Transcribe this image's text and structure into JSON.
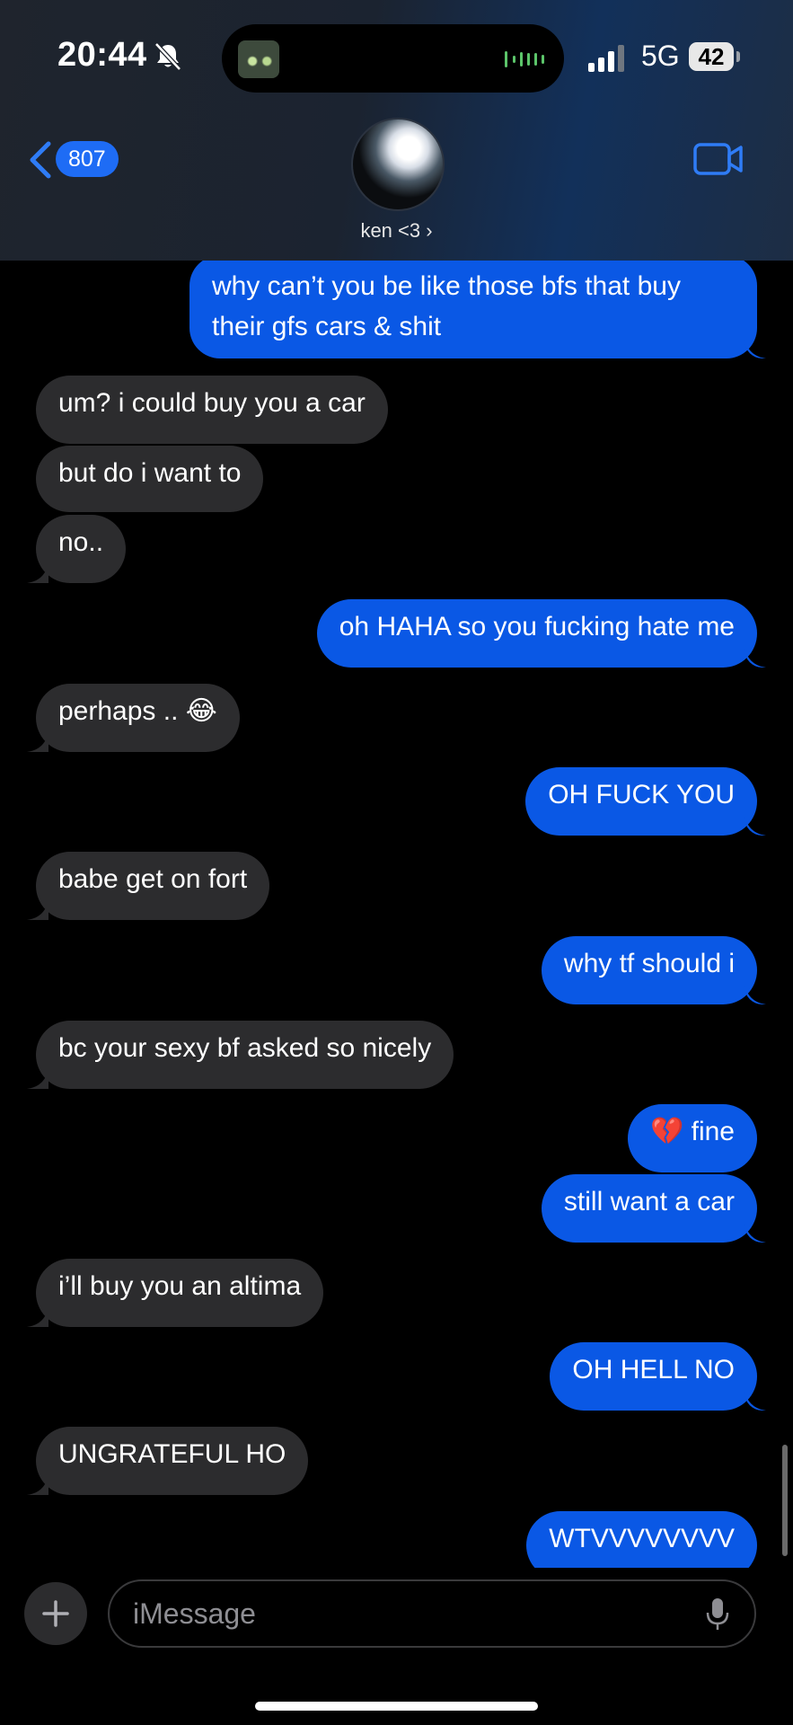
{
  "status_bar": {
    "time": "20:44",
    "network": "5G",
    "battery": "42"
  },
  "header": {
    "back_count": "807",
    "contact_name": "ken <3 ›"
  },
  "messages": [
    {
      "side": "sent",
      "text": "why can’t you be like those bfs that buy"
    },
    {
      "side": "sent",
      "text": "their gfs cars & shit"
    },
    {
      "side": "received",
      "text": "um? i could buy you a car"
    },
    {
      "side": "received",
      "text": "but do i want to"
    },
    {
      "side": "received",
      "text": "no.."
    },
    {
      "side": "sent",
      "text": "oh HAHA so you fucking hate me"
    },
    {
      "side": "received",
      "text": "perhaps .. 😂"
    },
    {
      "side": "sent",
      "text": "OH FUCK YOU"
    },
    {
      "side": "received",
      "text": "babe get on fort"
    },
    {
      "side": "sent",
      "text": "why tf should i"
    },
    {
      "side": "received",
      "text": "bc your sexy bf asked so nicely"
    },
    {
      "side": "sent",
      "text": "💔 fine"
    },
    {
      "side": "sent",
      "text": "still want a car"
    },
    {
      "side": "received",
      "text": "i’ll buy you an altima"
    },
    {
      "side": "sent",
      "text": "OH HELL NO"
    },
    {
      "side": "received",
      "text": "UNGRATEFUL HO"
    },
    {
      "side": "sent",
      "text": "WTVVVVVVVV"
    }
  ],
  "input": {
    "placeholder": "iMessage"
  },
  "icons": {
    "back": "chevron-left-icon",
    "video": "video-camera-icon",
    "plus": "plus-icon",
    "mic": "microphone-icon",
    "bell": "bell-slash-icon"
  },
  "colors": {
    "sent_bubble": "#0a58e5",
    "received_bubble": "#2c2c2e",
    "accent": "#1e6cf5"
  }
}
